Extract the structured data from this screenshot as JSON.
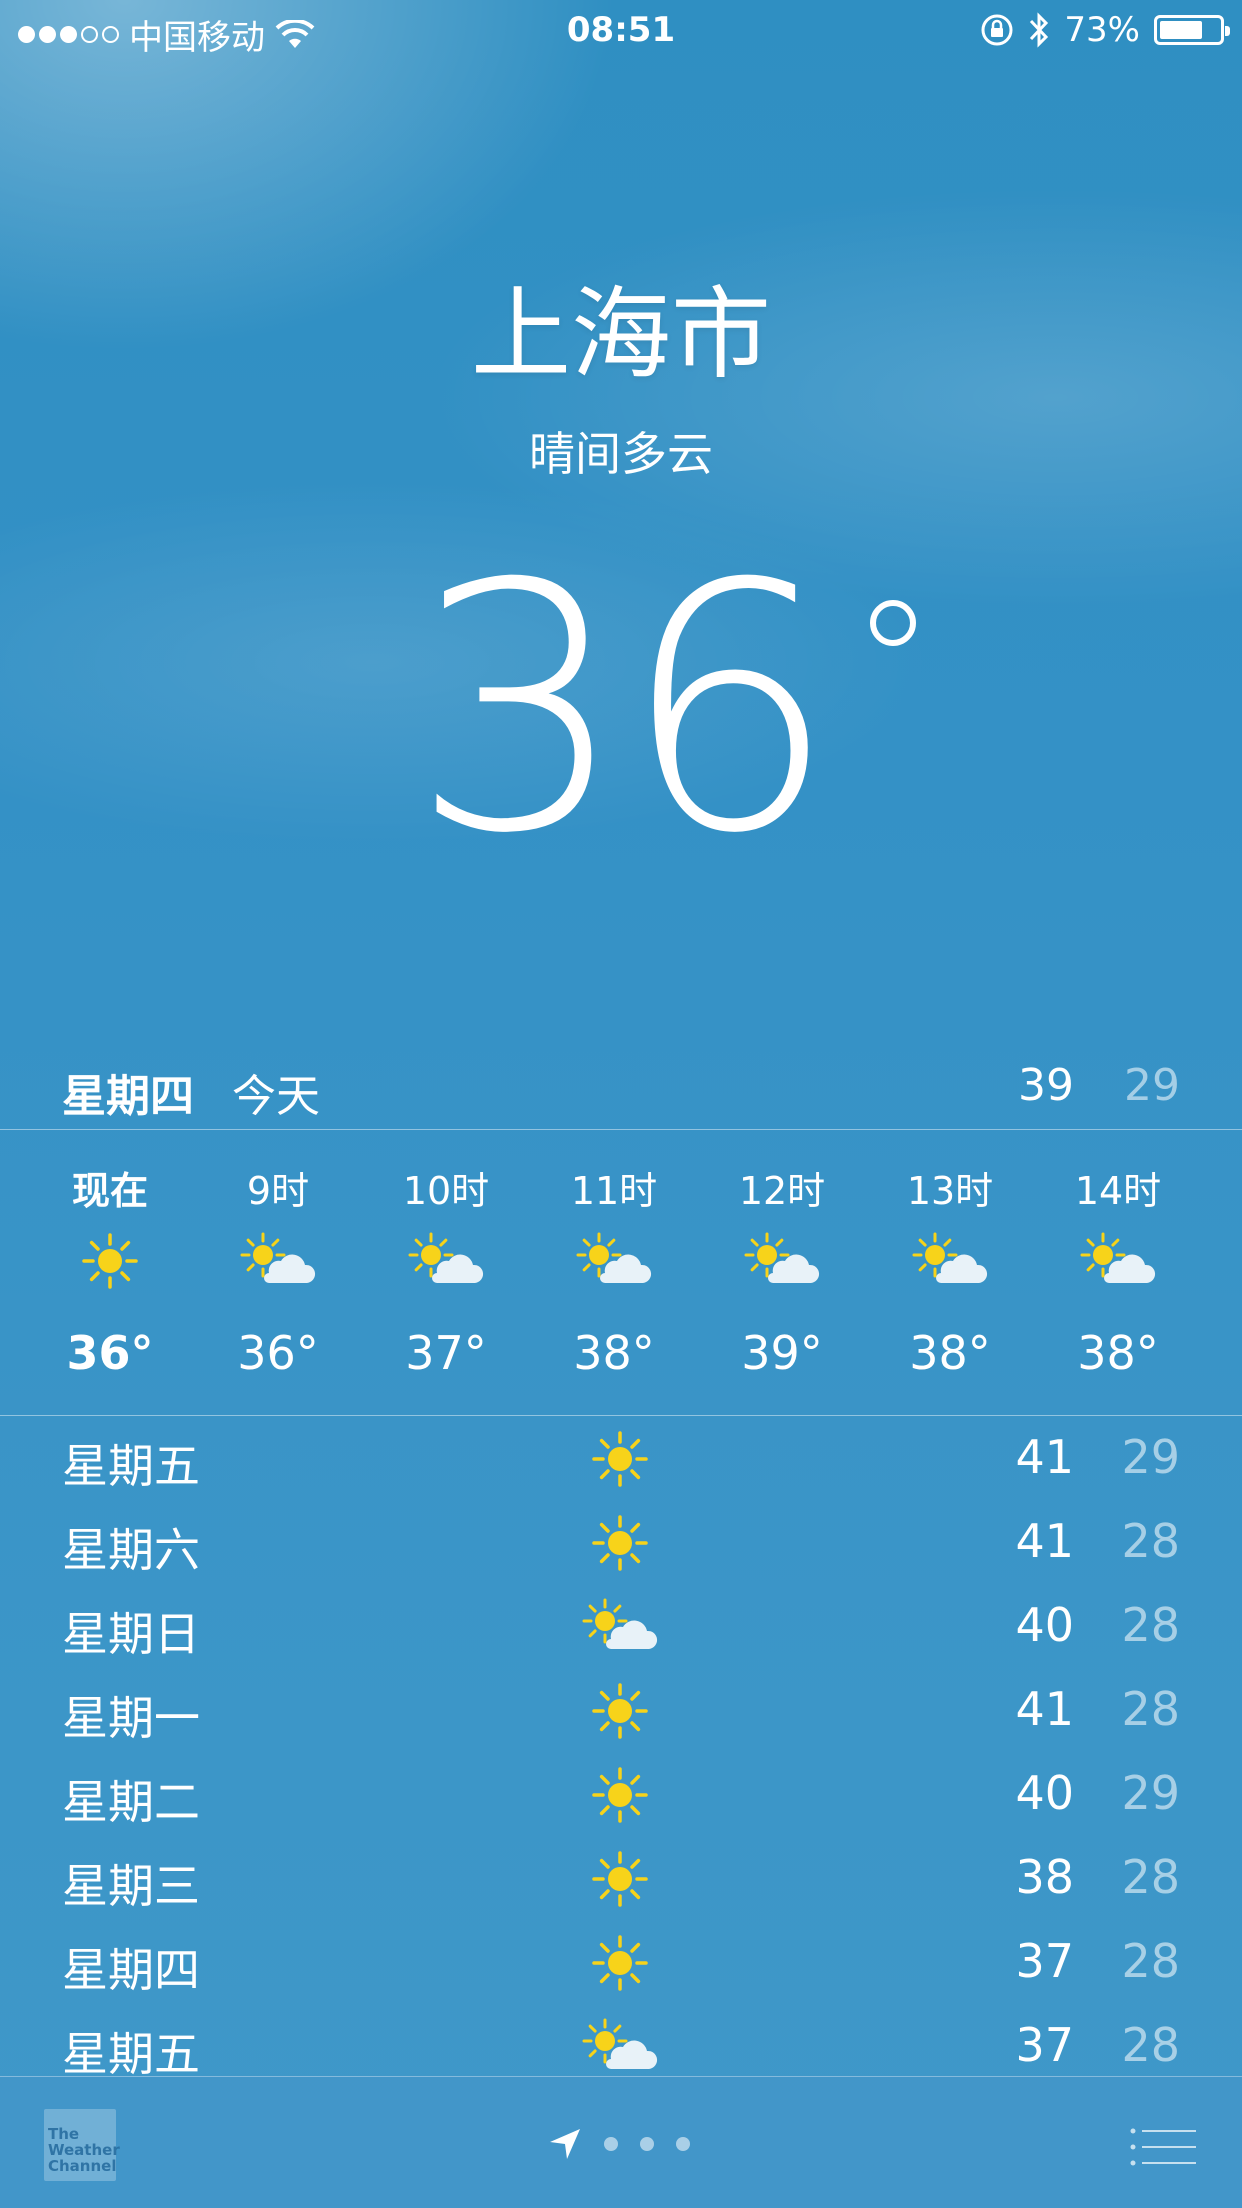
{
  "status_bar": {
    "carrier": "中国移动",
    "time": "08:51",
    "battery": "73%",
    "battery_level": 0.73,
    "signal_bars_filled": 3,
    "signal_bars_total": 5
  },
  "location": {
    "city": "上海市",
    "condition": "晴间多云",
    "current_temp": "36"
  },
  "today": {
    "day": "星期四",
    "label": "今天",
    "high": "39",
    "low": "29"
  },
  "hourly": [
    {
      "label": "现在",
      "icon": "sun-icon",
      "temp": "36°"
    },
    {
      "label": "9时",
      "icon": "partly-cloudy-icon",
      "temp": "36°"
    },
    {
      "label": "10时",
      "icon": "partly-cloudy-icon",
      "temp": "37°"
    },
    {
      "label": "11时",
      "icon": "partly-cloudy-icon",
      "temp": "38°"
    },
    {
      "label": "12时",
      "icon": "partly-cloudy-icon",
      "temp": "39°"
    },
    {
      "label": "13时",
      "icon": "partly-cloudy-icon",
      "temp": "38°"
    },
    {
      "label": "14时",
      "icon": "partly-cloudy-icon",
      "temp": "38°"
    }
  ],
  "daily": [
    {
      "day": "星期五",
      "icon": "sun-icon",
      "high": "41",
      "low": "29"
    },
    {
      "day": "星期六",
      "icon": "sun-icon",
      "high": "41",
      "low": "28"
    },
    {
      "day": "星期日",
      "icon": "partly-cloudy-icon",
      "high": "40",
      "low": "28"
    },
    {
      "day": "星期一",
      "icon": "sun-icon",
      "high": "41",
      "low": "28"
    },
    {
      "day": "星期二",
      "icon": "sun-icon",
      "high": "40",
      "low": "29"
    },
    {
      "day": "星期三",
      "icon": "sun-icon",
      "high": "38",
      "low": "28"
    },
    {
      "day": "星期四",
      "icon": "sun-icon",
      "high": "37",
      "low": "28"
    },
    {
      "day": "星期五",
      "icon": "partly-cloudy-icon",
      "high": "37",
      "low": "28"
    }
  ],
  "bottom_bar": {
    "logo_text": "The Weather Channel",
    "page_count": 3
  },
  "colors": {
    "sun": "#f7d31a",
    "cloud": "#e8f2f8",
    "low_temp": "rgba(255,255,255,0.55)"
  }
}
